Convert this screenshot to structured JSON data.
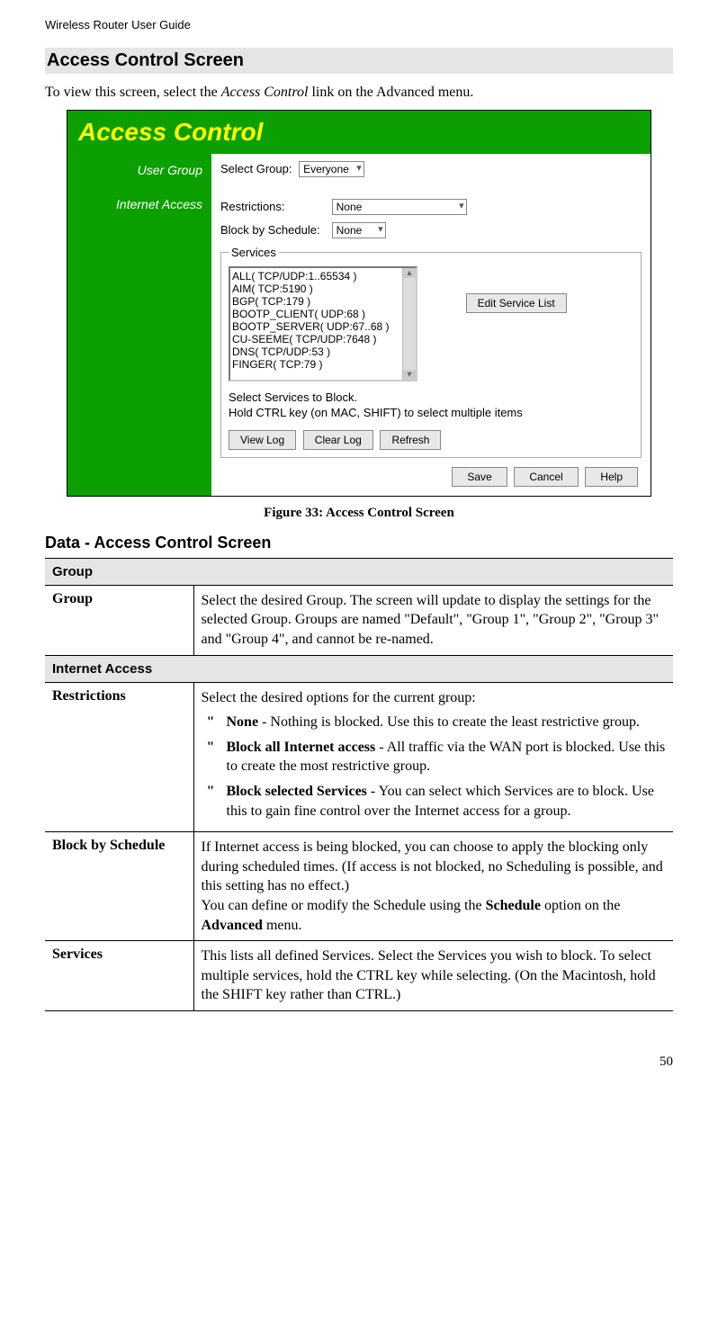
{
  "header": {
    "doc_title": "Wireless Router User Guide"
  },
  "section": {
    "title": "Access Control Screen",
    "intro_pre": "To view this screen, select the ",
    "intro_link": "Access Control",
    "intro_post": " link on the Advanced menu."
  },
  "screenshot": {
    "banner": "Access Control",
    "nav": {
      "user_group": "User Group",
      "internet_access": "Internet Access"
    },
    "select_group_label": "Select Group:",
    "select_group_value": "Everyone",
    "restrictions_label": "Restrictions:",
    "restrictions_value": "None",
    "block_schedule_label": "Block by Schedule:",
    "block_schedule_value": "None",
    "services_legend": "Services",
    "services_list": [
      "ALL( TCP/UDP:1..65534 )",
      "AIM( TCP:5190 )",
      "BGP( TCP:179 )",
      "BOOTP_CLIENT( UDP:68 )",
      "BOOTP_SERVER( UDP:67..68 )",
      "CU-SEEME( TCP/UDP:7648 )",
      "DNS( TCP/UDP:53 )",
      "FINGER( TCP:79 )"
    ],
    "edit_service_list_btn": "Edit Service List",
    "hint_line1": "Select Services to Block.",
    "hint_line2": "Hold CTRL key (on MAC, SHIFT) to select multiple items",
    "view_log_btn": "View Log",
    "clear_log_btn": "Clear Log",
    "refresh_btn": "Refresh",
    "save_btn": "Save",
    "cancel_btn": "Cancel",
    "help_btn": "Help"
  },
  "figure_caption": "Figure 33: Access Control Screen",
  "data_section": {
    "heading": "Data - Access Control Screen",
    "group_section": "Group",
    "group_label": "Group",
    "group_desc": "Select the desired Group. The screen will update to display the settings for the selected Group. Groups are named \"Default\", \"Group 1\", \"Group 2\", \"Group 3\" and \"Group 4\", and cannot be re-named.",
    "ia_section": "Internet Access",
    "restrictions_label": "Restrictions",
    "restrictions_intro": "Select the desired options for the current group:",
    "restrictions_items": [
      {
        "bold": "None",
        "rest": " - Nothing is blocked. Use this to create the least restrictive group."
      },
      {
        "bold": "Block all Internet access",
        "rest": " - All traffic via the WAN port is blocked. Use this to create the most restrictive group."
      },
      {
        "bold": "Block selected Services",
        "rest": " - You can select which Services are to block. Use this to gain fine control over the Internet access for a group."
      }
    ],
    "block_label": "Block by Schedule",
    "block_desc_pre": "If Internet access is being blocked, you can choose to apply the blocking only during scheduled times. (If access is not blocked, no Scheduling is possible, and this setting has no effect.)\nYou can define or modify the Schedule using the ",
    "block_desc_bold1": "Schedule",
    "block_desc_mid": " option on the ",
    "block_desc_bold2": "Advanced",
    "block_desc_end": " menu.",
    "services_label": "Services",
    "services_desc": "This lists all defined Services. Select the Services you wish to block. To select multiple services, hold the CTRL key while selecting. (On the Macintosh, hold the SHIFT key rather than CTRL.)"
  },
  "page_number": "50"
}
